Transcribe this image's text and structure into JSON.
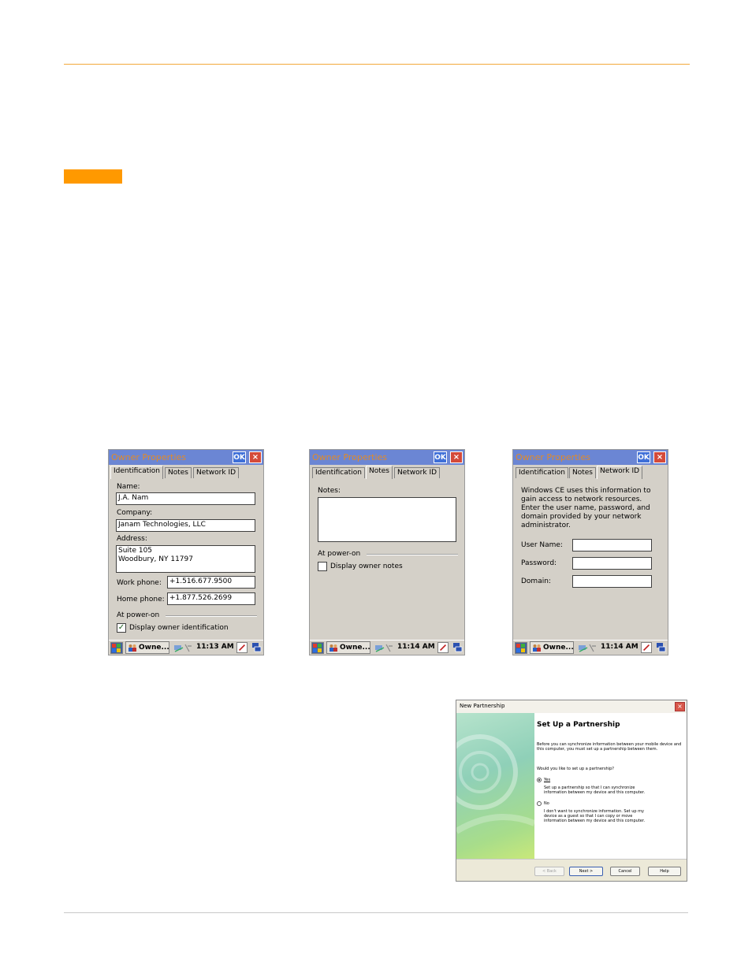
{
  "screens": [
    {
      "title": "Owner Properties",
      "ok_label": "OK",
      "close_label": "×",
      "tabs": [
        "Identification",
        "Notes",
        "Network ID"
      ],
      "active_tab": 0,
      "fields": {
        "name_label": "Name:",
        "name_value": "J.A. Nam",
        "company_label": "Company:",
        "company_value": "Janam Technologies, LLC",
        "address_label": "Address:",
        "address_value": "Suite 105\nWoodbury, NY 11797",
        "work_phone_label": "Work phone:",
        "work_phone_value": "+1.516.677.9500",
        "home_phone_label": "Home phone:",
        "home_phone_value": "+1.877.526.2699",
        "power_on_label": "At power-on",
        "checkbox_label": "Display owner identification",
        "checked": true
      },
      "taskbar": {
        "task_label": "Owne...",
        "clock": "11:13 AM"
      }
    },
    {
      "title": "Owner Properties",
      "ok_label": "OK",
      "close_label": "×",
      "tabs": [
        "Identification",
        "Notes",
        "Network ID"
      ],
      "active_tab": 1,
      "fields": {
        "notes_label": "Notes:",
        "notes_value": "",
        "power_on_label": "At power-on",
        "checkbox_label": "Display owner notes",
        "checked": false
      },
      "taskbar": {
        "task_label": "Owne...",
        "clock": "11:14 AM"
      }
    },
    {
      "title": "Owner Properties",
      "ok_label": "OK",
      "close_label": "×",
      "tabs": [
        "Identification",
        "Notes",
        "Network ID"
      ],
      "active_tab": 2,
      "fields": {
        "description": "Windows CE uses this information to gain access to network resources. Enter the user name, password, and domain provided by your network administrator.",
        "username_label": "User Name:",
        "username_value": "",
        "password_label": "Password:",
        "password_value": "",
        "domain_label": "Domain:",
        "domain_value": ""
      },
      "taskbar": {
        "task_label": "Owne...",
        "clock": "11:14 AM"
      }
    }
  ],
  "dialog": {
    "title": "New Partnership",
    "close_label": "×",
    "heading": "Set Up a Partnership",
    "intro": "Before you can synchronize information between your mobile device and this computer, you must set up a partnership between them.",
    "question": "Would you like to set up a partnership?",
    "options": [
      {
        "label": "Yes",
        "description": "Set up a partnership so that I can synchronize information between my device and this computer.",
        "selected": true
      },
      {
        "label": "No",
        "description": "I don't want to synchronize information. Set up my device as a guest so that I can copy or move information between my device and this computer.",
        "selected": false
      }
    ],
    "buttons": {
      "back": "< Back",
      "next": "Next >",
      "cancel": "Cancel",
      "help": "Help"
    }
  },
  "colors": {
    "accent_orange": "#ff9900",
    "rule_orange": "#f2a93b"
  }
}
